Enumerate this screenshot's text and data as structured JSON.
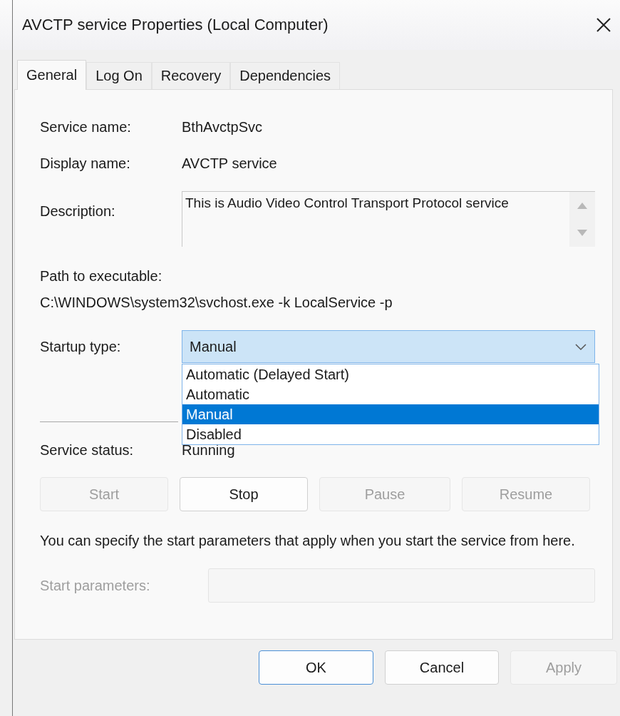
{
  "window": {
    "title": "AVCTP service Properties (Local Computer)"
  },
  "tabs": [
    {
      "label": "General",
      "selected": true
    },
    {
      "label": "Log On",
      "selected": false
    },
    {
      "label": "Recovery",
      "selected": false
    },
    {
      "label": "Dependencies",
      "selected": false
    }
  ],
  "service_name": {
    "label": "Service name:",
    "value": "BthAvctpSvc"
  },
  "display_name": {
    "label": "Display name:",
    "value": "AVCTP service"
  },
  "description": {
    "label": "Description:",
    "value": "This is Audio Video Control Transport Protocol service"
  },
  "path": {
    "label": "Path to executable:",
    "value": "C:\\WINDOWS\\system32\\svchost.exe -k LocalService -p"
  },
  "startup_type": {
    "label": "Startup type:",
    "value": "Manual",
    "expanded": true,
    "options": [
      {
        "label": "Automatic (Delayed Start)",
        "selected": false
      },
      {
        "label": "Automatic",
        "selected": false
      },
      {
        "label": "Manual",
        "selected": true
      },
      {
        "label": "Disabled",
        "selected": false
      }
    ]
  },
  "service_status": {
    "label": "Service status:",
    "value": "Running"
  },
  "control_buttons": [
    {
      "label": "Start",
      "disabled": true
    },
    {
      "label": "Stop",
      "disabled": false
    },
    {
      "label": "Pause",
      "disabled": true
    },
    {
      "label": "Resume",
      "disabled": true
    }
  ],
  "note": "You can specify the start parameters that apply when you start the service from here.",
  "start_parameters": {
    "label": "Start parameters:",
    "disabled": true
  },
  "dialog_buttons": [
    {
      "label": "OK",
      "disabled": false,
      "default": true
    },
    {
      "label": "Cancel",
      "disabled": false,
      "default": false
    },
    {
      "label": "Apply",
      "disabled": true,
      "default": false
    }
  ]
}
